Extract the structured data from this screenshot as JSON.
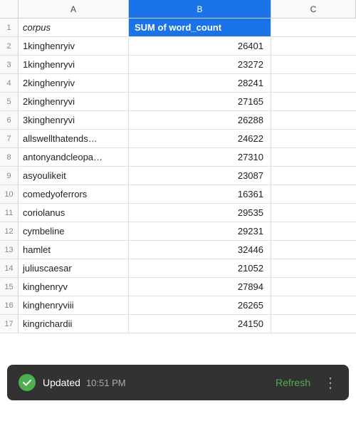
{
  "columns": {
    "a_label": "A",
    "b_label": "B",
    "c_label": "C"
  },
  "header_row": {
    "col_a": "corpus",
    "col_b": "SUM of word_count"
  },
  "rows": [
    {
      "num": 2,
      "col_a": "1kinghenryiv",
      "col_b": "26401"
    },
    {
      "num": 3,
      "col_a": "1kinghenryvi",
      "col_b": "23272"
    },
    {
      "num": 4,
      "col_a": "2kinghenryiv",
      "col_b": "28241"
    },
    {
      "num": 5,
      "col_a": "2kinghenryvi",
      "col_b": "27165"
    },
    {
      "num": 6,
      "col_a": "3kinghenryvi",
      "col_b": "26288"
    },
    {
      "num": 7,
      "col_a": "allswellthatends…",
      "col_b": "24622"
    },
    {
      "num": 8,
      "col_a": "antonyandcleopa…",
      "col_b": "27310"
    },
    {
      "num": 9,
      "col_a": "asyoulikeit",
      "col_b": "23087"
    },
    {
      "num": 10,
      "col_a": "comedyoferrors",
      "col_b": "16361"
    },
    {
      "num": 11,
      "col_a": "coriolanus",
      "col_b": "29535"
    },
    {
      "num": 12,
      "col_a": "cymbeline",
      "col_b": "29231"
    },
    {
      "num": 13,
      "col_a": "hamlet",
      "col_b": "32446"
    },
    {
      "num": 14,
      "col_a": "juliuscaesar",
      "col_b": "21052"
    },
    {
      "num": 15,
      "col_a": "kinghenryv",
      "col_b": "27894"
    },
    {
      "num": 16,
      "col_a": "kinghenryviii",
      "col_b": "26265"
    }
  ],
  "peek_row": {
    "num": 17,
    "col_a": "kingrichardii",
    "col_b": "24150"
  },
  "toast": {
    "status": "Updated",
    "time": "10:51 PM",
    "refresh_label": "Refresh",
    "more_icon": "⋮"
  }
}
